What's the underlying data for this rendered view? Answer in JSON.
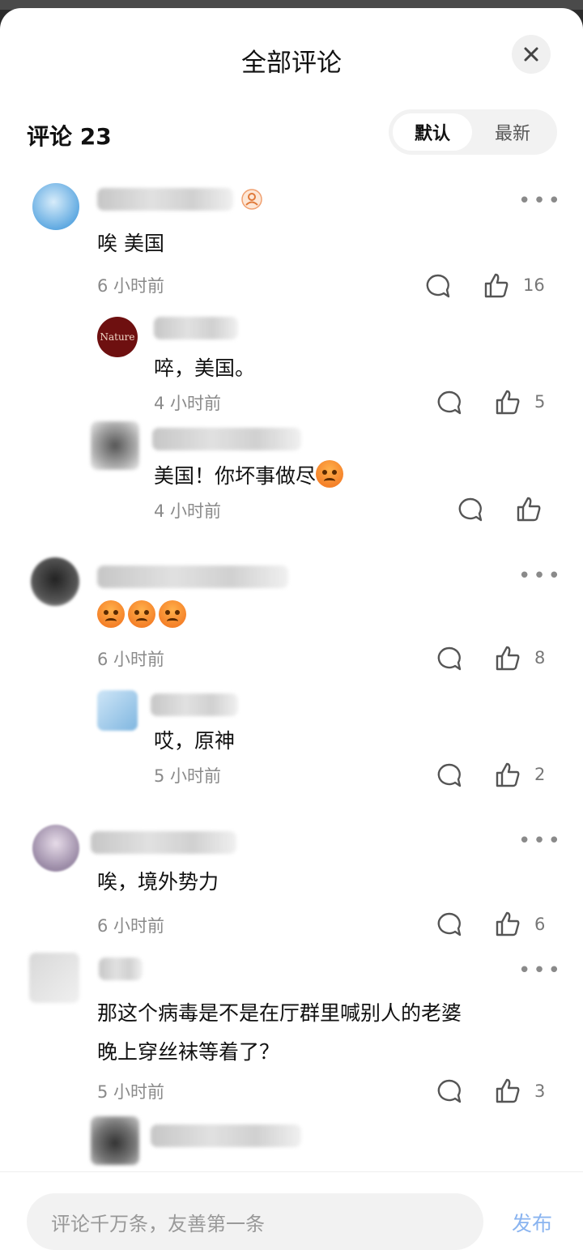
{
  "header": {
    "title": "全部评论",
    "close_icon": "close-icon"
  },
  "summary": {
    "count_label": "评论 23"
  },
  "sort": {
    "options": [
      "默认",
      "最新"
    ],
    "selected": "默认"
  },
  "comments": [
    {
      "text": "唉 美国",
      "time": "6 小时前",
      "likes": "16",
      "replies": [
        {
          "avatar_text": "Nature",
          "text": "啐，美国。",
          "time": "4 小时前",
          "likes": "5"
        },
        {
          "text": "美国！你坏事做尽",
          "time": "4 小时前",
          "likes": ""
        }
      ]
    },
    {
      "text": "",
      "time": "6 小时前",
      "likes": "8",
      "replies": [
        {
          "text": "哎，原神",
          "time": "5 小时前",
          "likes": "2"
        }
      ]
    },
    {
      "text": "唉，境外势力",
      "time": "6 小时前",
      "likes": "6"
    },
    {
      "text_line1": "那这个病毒是不是在厅群里喊别人的老婆",
      "text_line2": "晚上穿丝袜等着了？",
      "time": "5 小时前",
      "likes": "3"
    }
  ],
  "composer": {
    "placeholder": "评论千万条，友善第一条",
    "publish_label": "发布"
  },
  "colors": {
    "accent": "#8ab4f0",
    "muted": "#8a8a8a"
  }
}
